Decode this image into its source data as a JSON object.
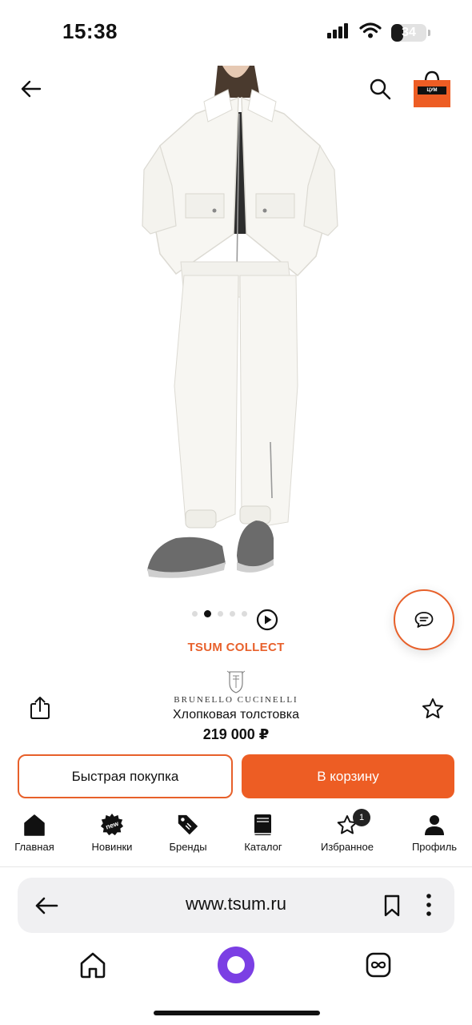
{
  "status_bar": {
    "time": "15:38",
    "battery": "34",
    "battery_level": 0.34
  },
  "header": {
    "cart_logo_text": "ЦУМ"
  },
  "carousel": {
    "dot_count": 5,
    "active_index": 1
  },
  "product": {
    "collection": "TSUM COLLECT",
    "brand": "BRUNELLO CUCINELLI",
    "name": "Хлопковая толстовка",
    "price": "219 000 ₽"
  },
  "actions": {
    "quick_buy_label": "Быстрая покупка",
    "add_to_cart_label": "В корзину"
  },
  "tab_bar": {
    "items": [
      {
        "label": "Главная",
        "icon": "home-icon"
      },
      {
        "label": "Новинки",
        "icon": "new-icon"
      },
      {
        "label": "Бренды",
        "icon": "tag-icon"
      },
      {
        "label": "Каталог",
        "icon": "catalog-book-icon"
      },
      {
        "label": "Избранное",
        "icon": "star-outline-icon",
        "badge": "1"
      },
      {
        "label": "Профиль",
        "icon": "person-icon"
      }
    ],
    "new_badge_text": "new"
  },
  "browser": {
    "url": "www.tsum.ru"
  },
  "colors": {
    "accent": "#ED5D24",
    "alice": "#7B3FE4",
    "text": "#111111"
  }
}
